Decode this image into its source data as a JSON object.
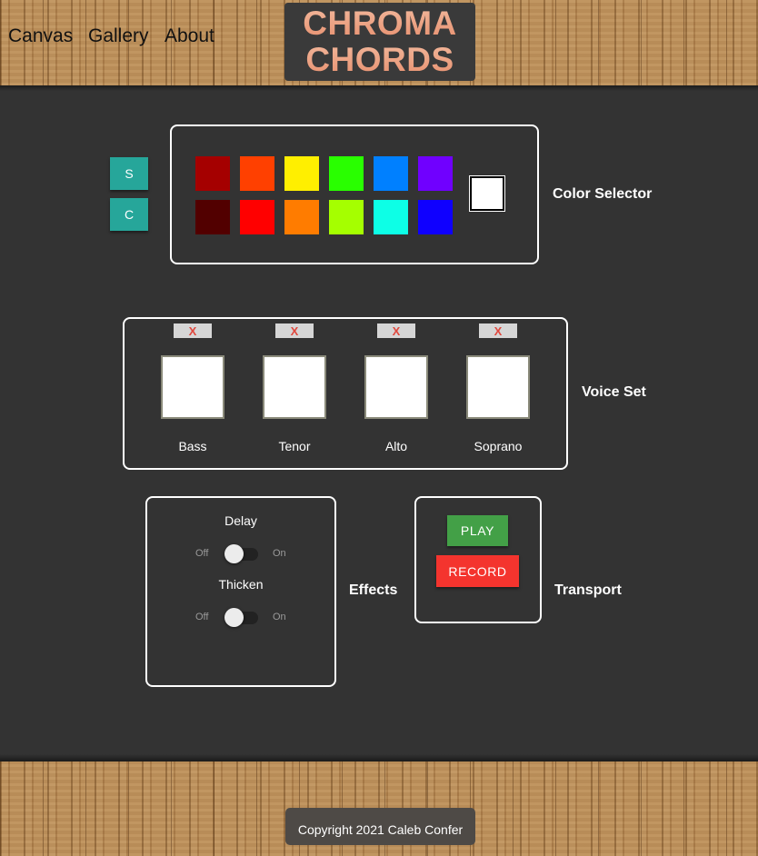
{
  "nav": {
    "items": [
      "Canvas",
      "Gallery",
      "About"
    ]
  },
  "logo": {
    "line1": "CHROMA",
    "line2": "CHORDS"
  },
  "color_selector": {
    "label": "Color Selector",
    "buttons": [
      "S",
      "C"
    ],
    "swatches_row1": [
      "#a50000",
      "#ff4000",
      "#ffef00",
      "#29ff00",
      "#0080ff",
      "#7000ff"
    ],
    "swatches_row2": [
      "#520000",
      "#ff0000",
      "#ff7c00",
      "#a5ff00",
      "#0dffe6",
      "#0f00ff"
    ],
    "current_color": "#ffffff"
  },
  "voice_set": {
    "label": "Voice Set",
    "remove_label": "X",
    "voices": [
      "Bass",
      "Tenor",
      "Alto",
      "Soprano"
    ]
  },
  "effects": {
    "label": "Effects",
    "off_label": "Off",
    "on_label": "On",
    "items": [
      {
        "name": "Delay",
        "on": false
      },
      {
        "name": "Thicken",
        "on": false
      }
    ]
  },
  "transport": {
    "label": "Transport",
    "play_label": "PLAY",
    "play_color": "#43a047",
    "record_label": "RECORD",
    "record_color": "#f4342e"
  },
  "footer": {
    "copyright": "Copyright 2021 Caleb Confer"
  }
}
